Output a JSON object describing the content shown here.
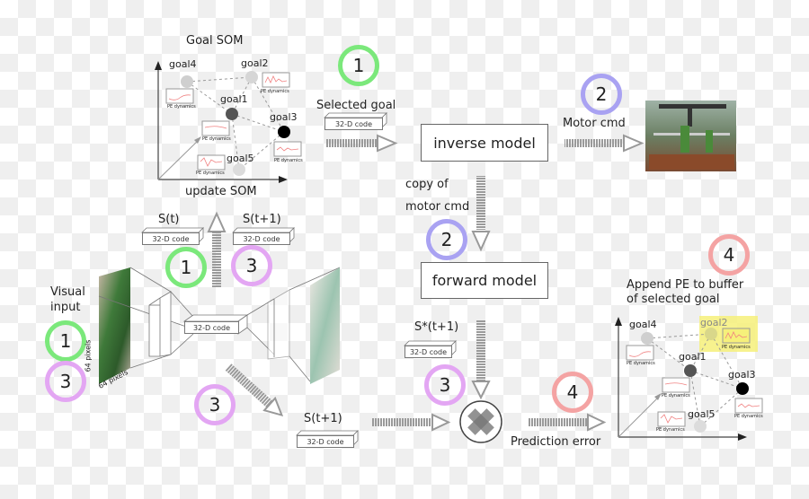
{
  "colors": {
    "step1": "#7be87b",
    "step2": "#a9a2f2",
    "step3": "#e3a6f3",
    "step4": "#f4a3a3",
    "highlight": "#f6f07a",
    "pe_line": "#f08080"
  },
  "goal_som": {
    "title": "Goal SOM",
    "update_label": "update SOM",
    "nodes": [
      {
        "label": "goal4",
        "shade": "#cfcfcf"
      },
      {
        "label": "goal2",
        "shade": "#d6d6d6"
      },
      {
        "label": "goal1",
        "shade": "#555555"
      },
      {
        "label": "goal3",
        "shade": "#000000"
      },
      {
        "label": "goal5",
        "shade": "#dcdcdc"
      }
    ],
    "pe_caption": "PE dynamics"
  },
  "selected_goal": {
    "label": "Selected goal",
    "code": "32-D code",
    "step": "1"
  },
  "inverse_model": {
    "label": "inverse model"
  },
  "motor_cmd": {
    "label": "Motor cmd",
    "step": "2",
    "photo_name": "robot-gantry-photo"
  },
  "copy_motor": {
    "line1": "copy of",
    "line2": "motor cmd",
    "step": "2"
  },
  "forward_model": {
    "label": "forward model"
  },
  "s_star": {
    "label": "S*(t+1)",
    "code": "32-D code",
    "step": "3"
  },
  "encoder": {
    "st_label": "S(t)",
    "st1_label": "S(t+1)",
    "code": "32-D code",
    "st_step": "1",
    "st1_step": "3",
    "bottleneck": "32-D code",
    "input_label_1": "Visual",
    "input_label_2": "input",
    "input_steps": [
      "1",
      "3"
    ],
    "dim_h": "64 pixels",
    "dim_w": "64 pixels"
  },
  "bottom": {
    "step": "3",
    "st1_label": "S(t+1)",
    "code": "32-D code"
  },
  "prediction": {
    "label": "Prediction error",
    "step": "4"
  },
  "append": {
    "step": "4",
    "line1": "Append PE to buffer",
    "line2": "of selected goal"
  }
}
